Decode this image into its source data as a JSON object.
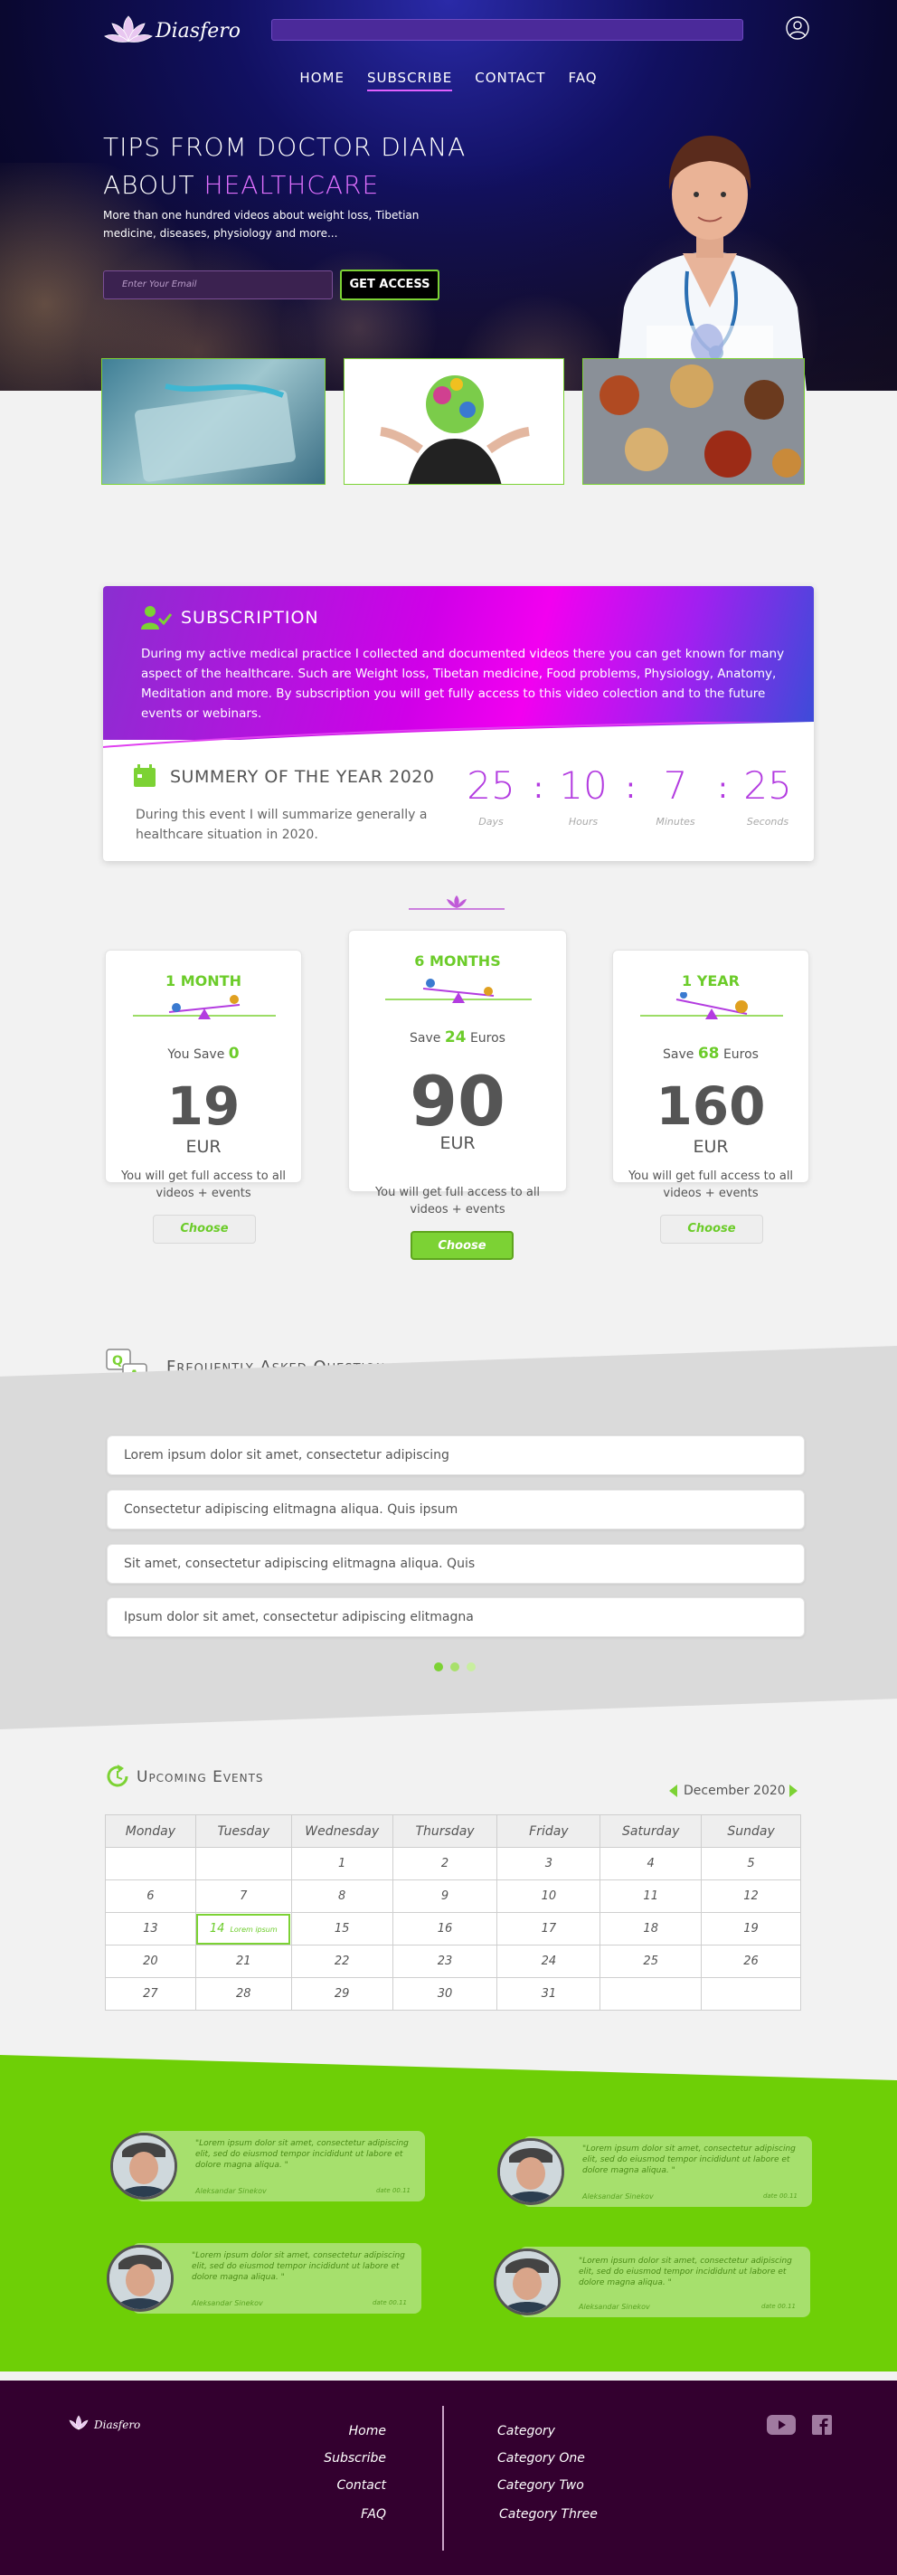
{
  "brand": {
    "name": "Diasfero"
  },
  "nav": {
    "items": [
      "HOME",
      "SUBSCRIBE",
      "CONTACT",
      "FAQ"
    ],
    "active": "SUBSCRIBE"
  },
  "hero": {
    "title_line1": "TIPS FROM DOCTOR DIANA",
    "title_line2_prefix": "ABOUT ",
    "title_line2_accent": "HEALTHCARE",
    "subtitle": "More than one hundred videos about weight loss, Tibetian medicine, diseases, physiology and more...",
    "email_placeholder": "Enter Your Email",
    "cta": "GET ACCESS"
  },
  "subscription": {
    "title": "SUBSCRIPTION",
    "text": "During my active medical practice I collected and documented videos there you can get known for many aspect of the healthcare. Such are  Weight loss,  Tibetan medicine, Food problems, Physiology, Anatomy, Meditation and more. By subscription you will get fully access to this video colection and to the future events or webinars.",
    "summary_title": "SUMMERY OF THE YEAR  2020",
    "summary_text": "During this event I will summarize generally a healthcare situation in 2020.",
    "countdown": {
      "days": "25",
      "hours": "10",
      "minutes": "7",
      "seconds": "25",
      "labels": {
        "days": "Days",
        "hours": "Hours",
        "minutes": "Minutes",
        "seconds": "Seconds"
      }
    }
  },
  "plans": [
    {
      "title": "1 MONTH",
      "save_prefix": "You Save ",
      "save_amount": "0",
      "save_suffix": "",
      "price": "19",
      "currency": "EUR",
      "desc": "You will get full access to all videos + events",
      "button": "Choose"
    },
    {
      "title": "6 MONTHS",
      "save_prefix": "Save ",
      "save_amount": "24",
      "save_suffix": " Euros",
      "price": "90",
      "currency": "EUR",
      "desc": "You will get full access to all videos + events",
      "button": "Choose"
    },
    {
      "title": "1 YEAR",
      "save_prefix": "Save ",
      "save_amount": "68",
      "save_suffix": " Euros",
      "price": "160",
      "currency": "EUR",
      "desc": "You will get full access to all videos + events",
      "button": "Choose"
    }
  ],
  "faq": {
    "title": "Frequently Asked Question",
    "items": [
      "Lorem ipsum dolor sit amet, consectetur adipiscing",
      "Consectetur adipiscing elitmagna aliqua. Quis ipsum",
      "Sit amet, consectetur adipiscing elitmagna aliqua. Quis",
      "Ipsum dolor sit amet, consectetur adipiscing elitmagna"
    ]
  },
  "events": {
    "title": "Upcoming Events",
    "month": "December 2020",
    "weekdays": [
      "Monday",
      "Tuesday",
      "Wednesday",
      "Thursday",
      "Friday",
      "Saturday",
      "Sunday"
    ],
    "weeks": [
      [
        "",
        "",
        "1",
        "2",
        "3",
        "4",
        "5"
      ],
      [
        "6",
        "7",
        "8",
        "9",
        "10",
        "11",
        "12"
      ],
      [
        "13",
        "14",
        "15",
        "16",
        "17",
        "18",
        "19"
      ],
      [
        "20",
        "21",
        "22",
        "23",
        "24",
        "25",
        "26"
      ],
      [
        "27",
        "28",
        "29",
        "30",
        "31",
        "",
        ""
      ]
    ],
    "highlight_note": "Lorem ipsum"
  },
  "testimonials": [
    {
      "quote": "\"Lorem ipsum dolor sit amet, consectetur adipiscing elit, sed do eiusmod tempor incididunt ut labore et dolore magna aliqua. \"",
      "name": "Aleksandar Sinekov",
      "date": "date 00.11"
    },
    {
      "quote": "\"Lorem ipsum dolor sit amet, consectetur adipiscing elit, sed do eiusmod tempor incididunt ut labore et dolore magna aliqua. \"",
      "name": "Aleksandar Sinekov",
      "date": "date 00.11"
    },
    {
      "quote": "\"Lorem ipsum dolor sit amet, consectetur adipiscing elit, sed do eiusmod tempor incididunt ut labore et dolore magna aliqua. \"",
      "name": "Aleksandar Sinekov",
      "date": "date 00.11"
    },
    {
      "quote": "\"Lorem ipsum dolor sit amet, consectetur adipiscing elit, sed do eiusmod tempor incididunt ut labore et dolore magna aliqua. \"",
      "name": "Aleksandar Sinekov",
      "date": "date 00.11"
    }
  ],
  "footer": {
    "links": [
      "Home",
      "Subscribe",
      "Contact",
      "FAQ"
    ],
    "categories": [
      "Category",
      "Category One",
      "Category Two",
      "Category Three"
    ]
  },
  "colors": {
    "accent_green": "#7cd234",
    "accent_purple": "#e070ff",
    "footer_bg": "#33002f"
  }
}
